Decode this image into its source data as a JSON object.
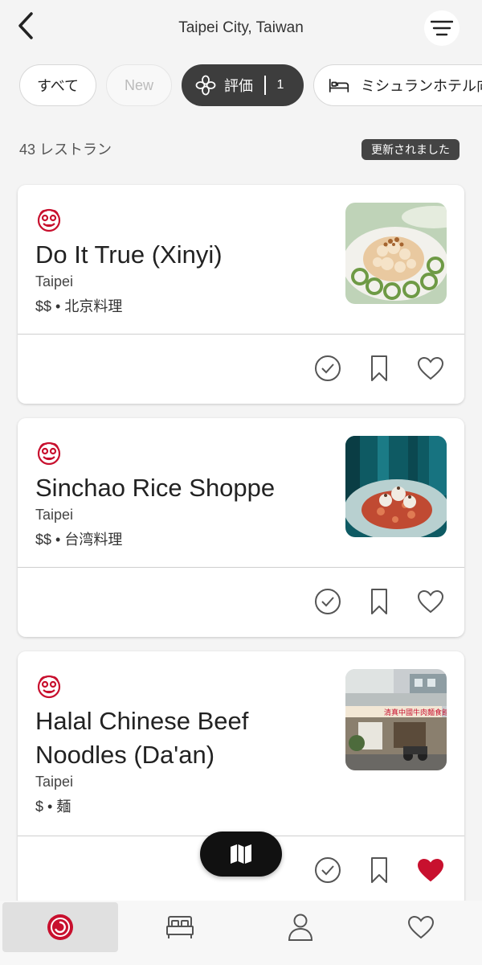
{
  "header": {
    "title": "Taipei City, Taiwan",
    "back_icon": "chevron-left-icon",
    "filter_icon": "filter-lines-icon"
  },
  "chips": {
    "all": "すべて",
    "new": "New",
    "rating_label": "評価",
    "rating_count": "1",
    "hotel_label": "ミシュランホテル向"
  },
  "results": {
    "count_text": "43 レストラン",
    "updated_badge": "更新されました"
  },
  "restaurants": [
    {
      "name": "Do It True (Xinyi)",
      "city": "Taipei",
      "price_cuisine": "$$ • 北京料理",
      "favorited": false
    },
    {
      "name": "Sinchao Rice Shoppe",
      "city": "Taipei",
      "price_cuisine": "$$ • 台湾料理",
      "favorited": false
    },
    {
      "name": "Halal Chinese Beef Noodles (Da'an)",
      "city": "Taipei",
      "price_cuisine": "$ • 麺",
      "favorited": true
    }
  ],
  "colors": {
    "michelin_red": "#c8102e",
    "heart_filled": "#c8102e",
    "chip_active_bg": "#3d3d3d",
    "badge_bg": "#444444"
  },
  "bottom_nav": {
    "items": [
      "explore-icon",
      "hotel-bed-icon",
      "profile-icon",
      "favorites-heart-icon"
    ],
    "active": "explore-icon"
  }
}
